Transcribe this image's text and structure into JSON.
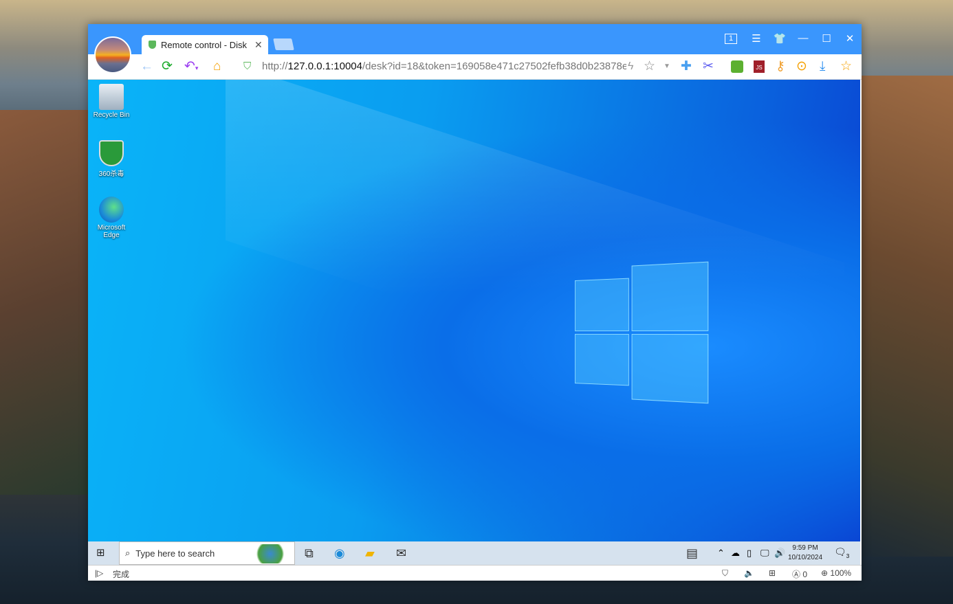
{
  "browser": {
    "tab_title": "Remote control - Disk",
    "url_prefix": "http://",
    "url_host": "127.0.0.1:10004",
    "url_path": "/desk?id=18&token=169058e471c27502fefb38d0b23878e",
    "window_count": "1",
    "status_text": "完成",
    "ad_count": "0",
    "zoom": "100%"
  },
  "desktop": {
    "icons": [
      {
        "label": "Recycle Bin"
      },
      {
        "label": "360杀毒"
      },
      {
        "label": "Microsoft Edge"
      }
    ],
    "taskbar": {
      "search_placeholder": "Type here to search",
      "time": "9:59 PM",
      "date": "10/10/2024",
      "notifications": "3"
    }
  },
  "colors": {
    "titlebar": "#3a96fd",
    "desktop": "#0a9df0"
  }
}
